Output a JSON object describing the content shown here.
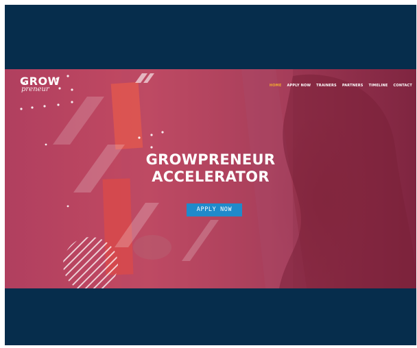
{
  "logo": {
    "top": "GROW",
    "bottom": "preneur"
  },
  "nav": {
    "items": [
      {
        "label": "HOME",
        "active": true
      },
      {
        "label": "APPLY NOW",
        "active": false
      },
      {
        "label": "TRAINERS",
        "active": false
      },
      {
        "label": "PARTNERS",
        "active": false
      },
      {
        "label": "TIMELINE",
        "active": false
      },
      {
        "label": "CONTACT",
        "active": false
      }
    ]
  },
  "hero": {
    "title_line1": "GROWPRENEUR",
    "title_line2": "ACCELERATOR",
    "cta_label": "APPLY NOW"
  },
  "colors": {
    "frame_background": "#062d4c",
    "hero_overlay": "#c24a62",
    "nav_active": "#f0a830",
    "cta_background": "#1f8acb"
  }
}
